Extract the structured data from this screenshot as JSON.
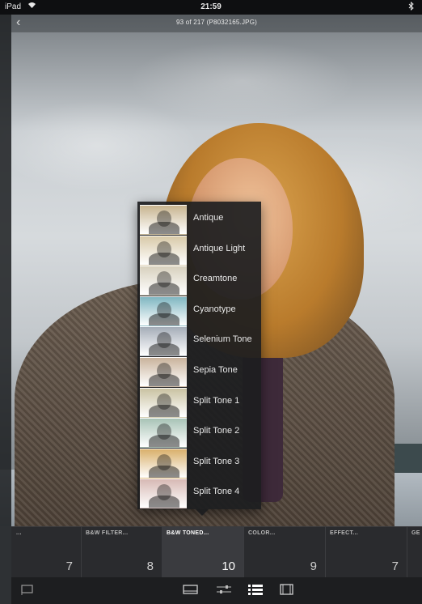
{
  "status_bar": {
    "carrier": "iPad",
    "time": "21:59"
  },
  "header": {
    "back_icon": "chevron-left-icon",
    "photo_title": "93 of 217 (P8032165.JPG)"
  },
  "filter_popup": {
    "presets": [
      {
        "label": "Antique",
        "tint": "#c7b48f"
      },
      {
        "label": "Antique Light",
        "tint": "#d8c9a8"
      },
      {
        "label": "Creamtone",
        "tint": "#d7d0bd"
      },
      {
        "label": "Cyanotype",
        "tint": "#7fb6c1"
      },
      {
        "label": "Selenium Tone",
        "tint": "#a5adb8"
      },
      {
        "label": "Sepia Tone",
        "tint": "#c9b39c"
      },
      {
        "label": "Split Tone 1",
        "tint": "#c9c2a2"
      },
      {
        "label": "Split Tone 2",
        "tint": "#a8c3b6"
      },
      {
        "label": "Split Tone 3",
        "tint": "#d9b06b"
      },
      {
        "label": "Split Tone 4",
        "tint": "#d7b9b4"
      }
    ]
  },
  "categories": [
    {
      "name": "...",
      "count": "7"
    },
    {
      "name": "B&W FILTER...",
      "count": "8"
    },
    {
      "name": "B&W TONED...",
      "count": "10",
      "active": true
    },
    {
      "name": "COLOR...",
      "count": "9"
    },
    {
      "name": "EFFECT...",
      "count": "7"
    },
    {
      "name": "GE",
      "count": ""
    }
  ],
  "toolbar": {
    "icons": [
      "flag-icon",
      "crop-icon",
      "adjust-sliders-icon",
      "presets-list-icon",
      "frame-icon"
    ]
  }
}
